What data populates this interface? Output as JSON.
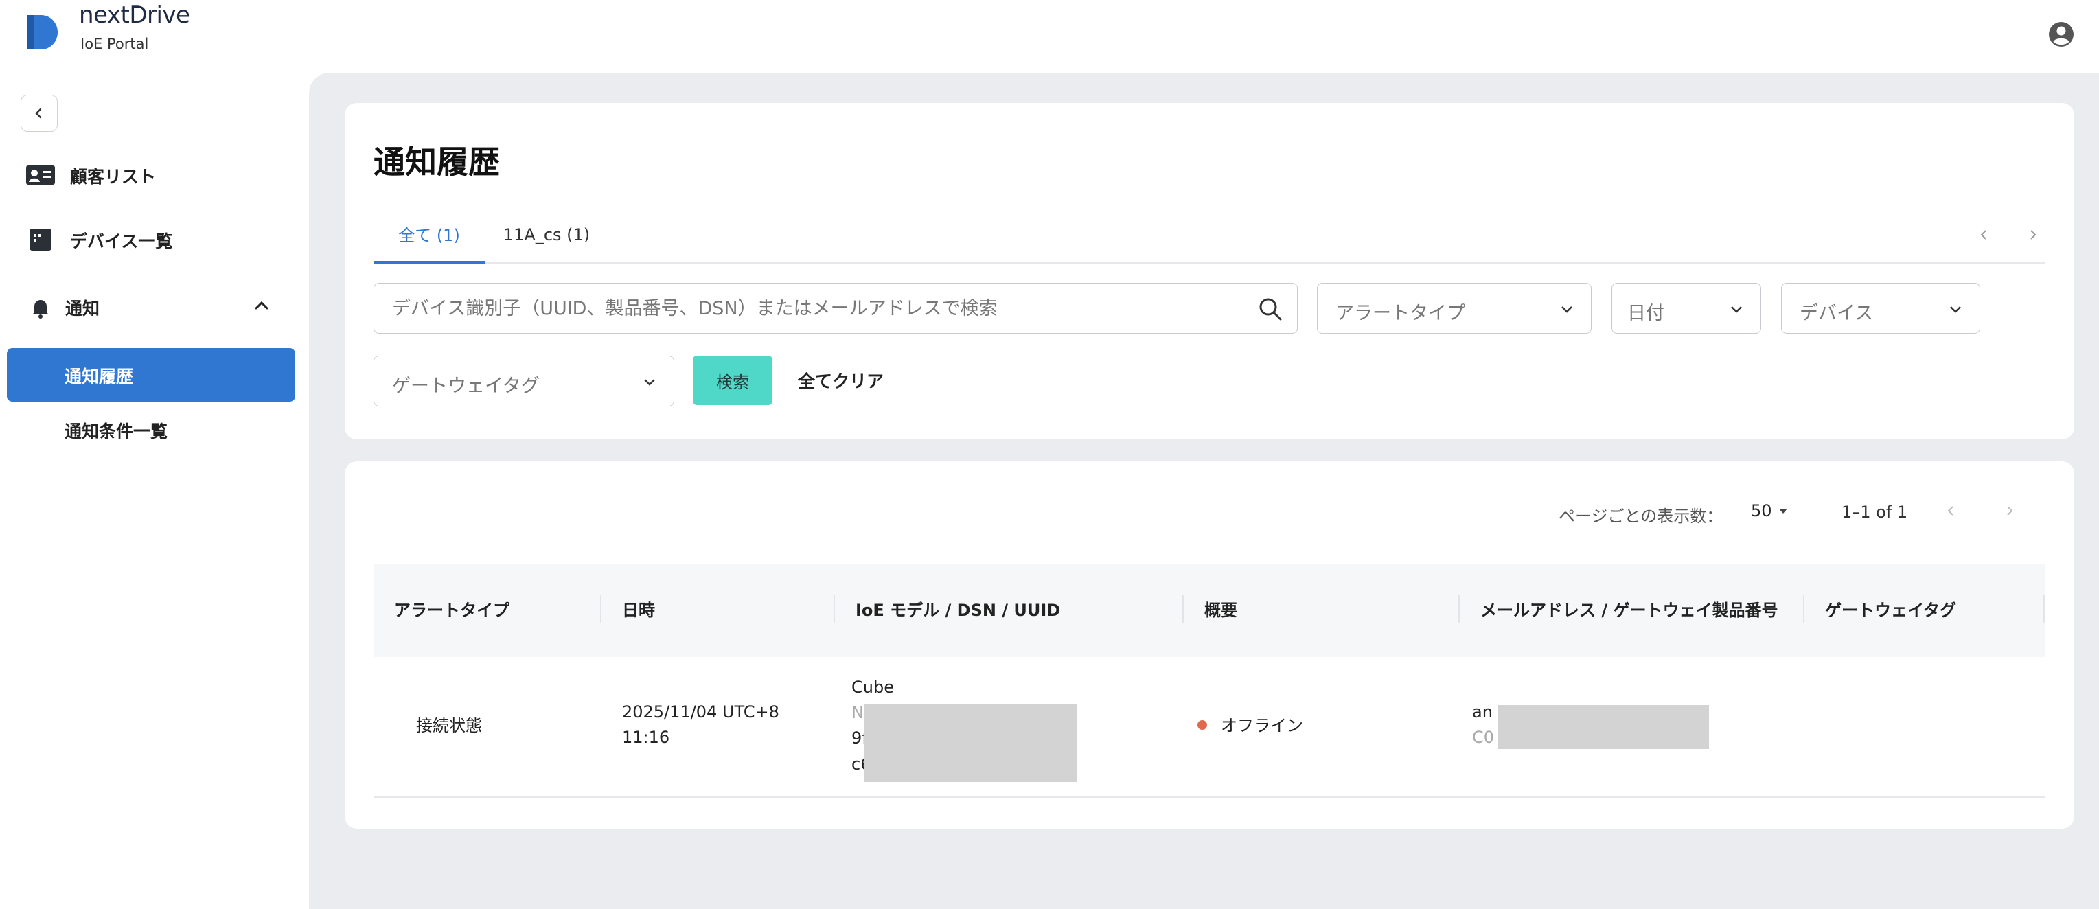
{
  "brand": {
    "name": "nextDrive",
    "subtitle": "IoE Portal",
    "accent": "#2f77d0"
  },
  "sidebar": {
    "items": [
      {
        "label": "顧客リスト",
        "icon": "customer-card-icon"
      },
      {
        "label": "デバイス一覧",
        "icon": "device-icon"
      },
      {
        "label": "通知",
        "icon": "bell-icon",
        "expanded": true
      }
    ],
    "subitems": [
      {
        "label": "通知履歴",
        "active": true
      },
      {
        "label": "通知条件一覧",
        "active": false
      }
    ]
  },
  "page": {
    "title": "通知履歴"
  },
  "tabs": [
    {
      "label": "全て (1)",
      "active": true
    },
    {
      "label": "11A_cs (1)",
      "active": false
    }
  ],
  "filters": {
    "search_placeholder": "デバイス識別子（UUID、製品番号、DSN）またはメールアドレスで検索",
    "alert_type": "アラートタイプ",
    "date": "日付",
    "device": "デバイス",
    "gateway_tag": "ゲートウェイタグ",
    "search_button": "検索",
    "clear_all": "全てクリア"
  },
  "pagination": {
    "per_page_label": "ページごとの表示数：",
    "per_page_value": "50",
    "range": "1–1 of 1"
  },
  "table": {
    "headers": [
      "アラートタイプ",
      "日時",
      "IoE モデル / DSN / UUID",
      "概要",
      "メールアドレス / ゲートウェイ製品番号",
      "ゲートウェイタグ"
    ],
    "rows": [
      {
        "alert_type": "接続状態",
        "datetime_line1": "2025/11/04 UTC+8",
        "datetime_line2": "11:16",
        "model": "Cube",
        "dsn_prefix": "N",
        "uuid_prefix1": "9f",
        "uuid_prefix2": "c6",
        "summary": "オフライン",
        "status_color": "#e06a50",
        "email_prefix": "an",
        "gateway_prefix": "C0",
        "gateway_tag": ""
      }
    ]
  }
}
